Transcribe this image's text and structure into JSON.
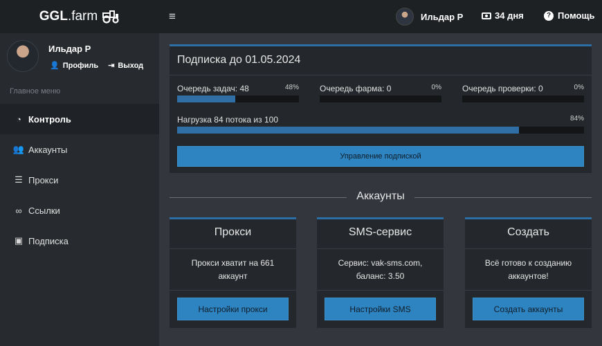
{
  "header": {
    "logo_bold": "GGL",
    "logo_rest": ".farm",
    "user_name": "Ильдар Р",
    "days": "34 дня",
    "help": "Помощь"
  },
  "sidebar": {
    "profile_name": "Ильдар Р",
    "profile_link": "Профиль",
    "logout_link": "Выход",
    "menu_title": "Главное меню",
    "items": [
      {
        "label": "Контроль",
        "icon": "gauge-icon"
      },
      {
        "label": "Аккаунты",
        "icon": "users-icon"
      },
      {
        "label": "Прокси",
        "icon": "server-icon"
      },
      {
        "label": "Ссылки",
        "icon": "link-icon"
      },
      {
        "label": "Подписка",
        "icon": "money-icon"
      }
    ]
  },
  "subscription": {
    "title": "Подписка до 01.05.2024",
    "queues": [
      {
        "label": "Очередь задач: 48",
        "percent_label": "48%",
        "fill": 0.48
      },
      {
        "label": "Очередь фарма: 0",
        "percent_label": "0%",
        "fill": 0
      },
      {
        "label": "Очередь проверки: 0",
        "percent_label": "0%",
        "fill": 0
      }
    ],
    "load": {
      "label": "Нагрузка 84 потока из 100",
      "percent_label": "84%",
      "fill": 0.84
    },
    "manage_button": "Управление подпиской"
  },
  "accounts_section": {
    "title": "Аккаунты",
    "cards": [
      {
        "title": "Прокси",
        "line1": "Прокси хватит на 661",
        "line2": "аккаунт",
        "button": "Настройки прокси"
      },
      {
        "title": "SMS-сервис",
        "line1": "Сервис: vak-sms.com,",
        "line2": "баланс: 3.50",
        "button": "Настройки SMS"
      },
      {
        "title": "Создать",
        "line1": "Всё готово к созданию",
        "line2": "аккаунтов!",
        "button": "Создать аккаунты"
      }
    ]
  },
  "colors": {
    "accent": "#2e84c0",
    "bar_fill": "#2f6fa6",
    "background": "#33373d",
    "sidebar": "#272a2e",
    "header": "#1e2124"
  }
}
